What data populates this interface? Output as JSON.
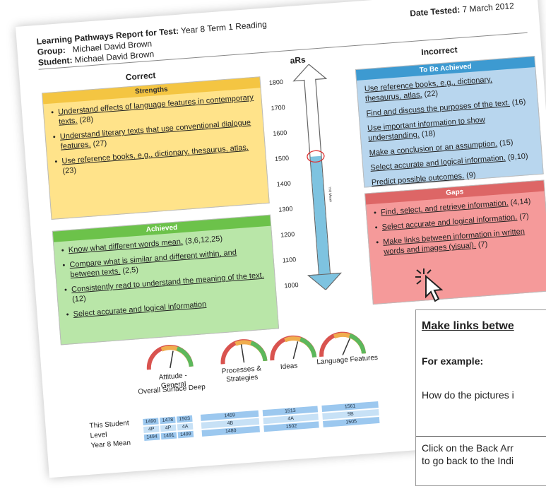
{
  "header": {
    "report_label": "Learning Pathways Report for Test:",
    "test_name": "Year 8 Term 1 Reading",
    "group_label": "Group:",
    "group_value": "Michael David Brown",
    "student_label": "Student:",
    "student_value": "Michael David Brown",
    "date_label": "Date Tested:",
    "date_value": "7 March 2012"
  },
  "correct_heading": "Correct",
  "incorrect_heading": "Incorrect",
  "strengths": {
    "title": "Strengths",
    "items": [
      {
        "link": "Understand effects of language features in contemporary texts.",
        "ref": "(28)"
      },
      {
        "link": "Understand literary texts that use conventional dialogue features.",
        "ref": "(27)"
      },
      {
        "link": "Use reference books, e.g., dictionary, thesaurus, atlas.",
        "ref": "(23)"
      }
    ]
  },
  "achieved": {
    "title": "Achieved",
    "items": [
      {
        "link": "Know what different words mean.",
        "ref": "(3,6,12,25)"
      },
      {
        "link": "Compare what is similar and different within, and between texts.",
        "ref": "(2,5)"
      },
      {
        "link": "Consistently read to understand the meaning of the text.",
        "ref": "(12)"
      },
      {
        "link": "Select accurate and logical information",
        "ref": ""
      }
    ]
  },
  "to_be_achieved": {
    "title": "To Be Achieved",
    "items": [
      {
        "link": "Use reference books, e.g., dictionary, thesaurus, atlas.",
        "ref": "(22)"
      },
      {
        "link": "Find and discuss the purposes of the text.",
        "ref": "(16)"
      },
      {
        "link": "Use important information to show understanding.",
        "ref": "(18)"
      },
      {
        "link": "Make a conclusion or an assumption.",
        "ref": "(15)"
      },
      {
        "link": "Select accurate and logical information.",
        "ref": "(9,10)"
      },
      {
        "link": "Predict possible outcomes.",
        "ref": "(9)"
      }
    ]
  },
  "gaps": {
    "title": "Gaps",
    "items": [
      {
        "link": "Find, select, and retrieve information.",
        "ref": "(4,14)"
      },
      {
        "link": "Select accurate and logical information.",
        "ref": "(7)"
      },
      {
        "link": "Make links between information in written words and images (visual).",
        "ref": "(7)"
      }
    ]
  },
  "scale": {
    "title": "aRs",
    "ticks": [
      "1800",
      "1700",
      "1600",
      "1500",
      "1400",
      "1300",
      "1200",
      "1100",
      "1000"
    ],
    "student_value": 1500,
    "side_label": "Yr8 Mean"
  },
  "gauges": {
    "labels": [
      "Attitude - General",
      "Processes & Strategies",
      "Ideas",
      "Language Features"
    ],
    "attitude_sub": [
      "Overall",
      "Surface",
      "Deep"
    ]
  },
  "table": {
    "row_labels": [
      "This Student",
      "Level",
      "Year 8 Mean"
    ],
    "attitude": {
      "student": [
        "1490",
        "1478",
        "1503"
      ],
      "level": [
        "4P",
        "4P",
        "4A"
      ],
      "mean": [
        "1494",
        "1491",
        "1499"
      ]
    },
    "processes": {
      "student": "1459",
      "level": "4B",
      "mean": "1480"
    },
    "ideas": {
      "student": "1513",
      "level": "4A",
      "mean": "1502"
    },
    "language": {
      "student": "1561",
      "level": "5B",
      "mean": "1505"
    }
  },
  "popup": {
    "title": "Make links betwe",
    "example_label": "For example:",
    "question": "How do the pictures i",
    "footer_line1": "Click on the Back Arr",
    "footer_line2": "to go back to the Indi"
  },
  "colors": {
    "strengths_bg": "#ffe38a",
    "achieved_bg": "#b9e6a8",
    "to_be_achieved_bg": "#b8d6ee",
    "gaps_bg": "#f59a9a",
    "arrow_fill": "#7ec3e0"
  }
}
